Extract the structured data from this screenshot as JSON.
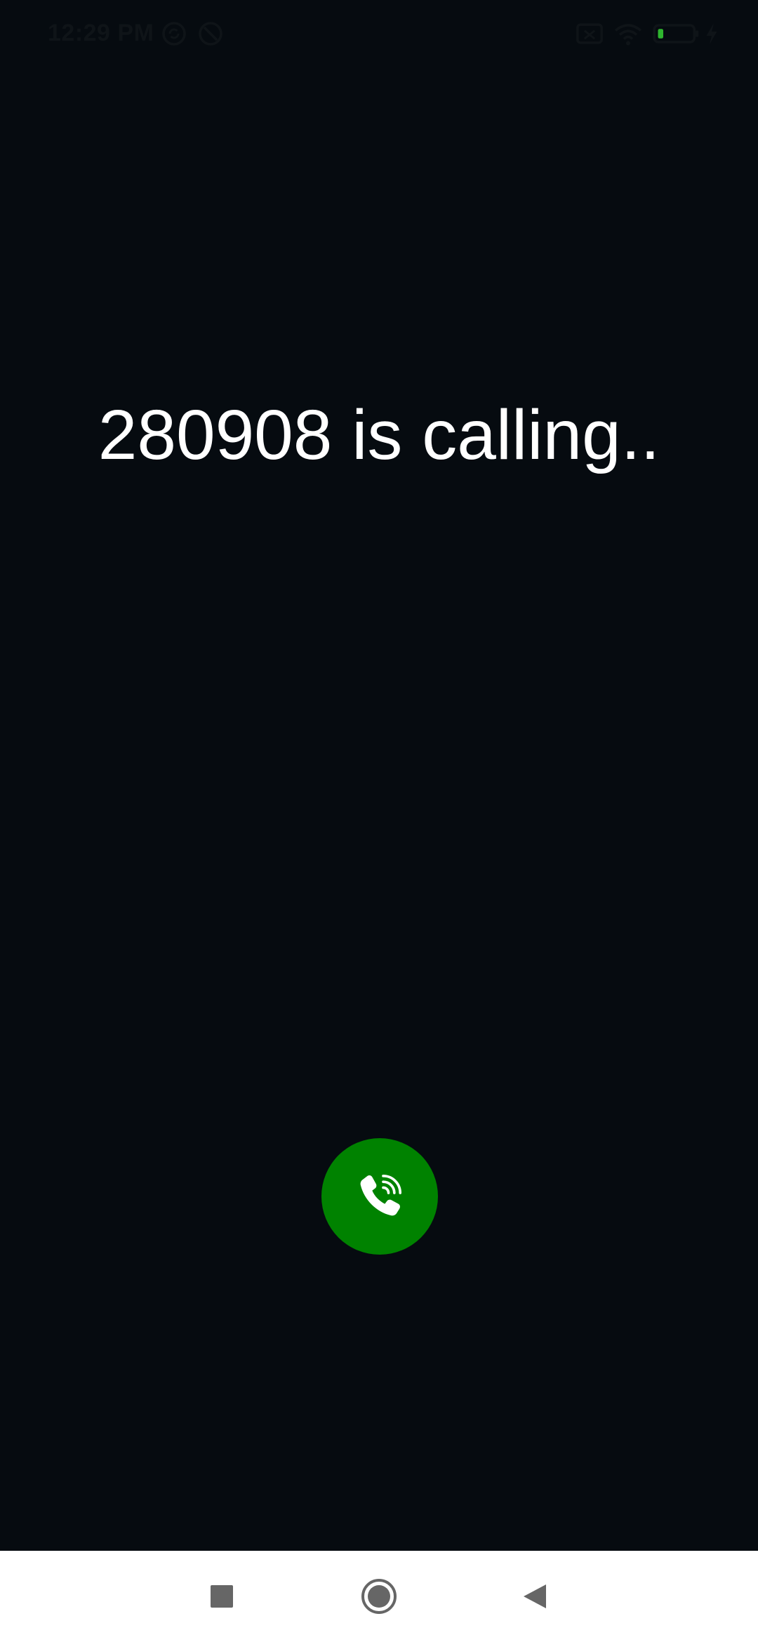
{
  "status_bar": {
    "time": "12:29 PM",
    "icons": [
      "sync-icon",
      "do-not-disturb-icon",
      "sim-icon",
      "wifi-icon",
      "battery-icon",
      "charging-icon"
    ],
    "battery_level": "5"
  },
  "call": {
    "caller_text": "280908 is calling.."
  },
  "answer_button": {
    "icon": "phone-ringing-icon",
    "color": "#008200"
  },
  "nav_bar": {
    "buttons": [
      "recents-square-icon",
      "home-circle-icon",
      "back-triangle-icon"
    ]
  },
  "colors": {
    "background": "#060b10",
    "text": "#ffffff",
    "nav_background": "#ffffff"
  }
}
